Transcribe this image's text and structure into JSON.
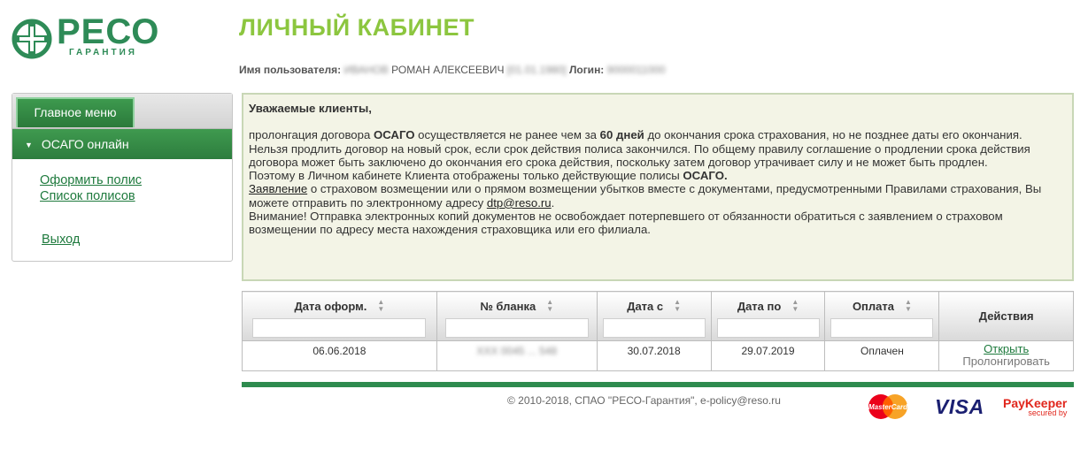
{
  "brand": {
    "name": "РЕСО",
    "subtitle": "ГАРАНТИЯ"
  },
  "header": {
    "title": "ЛИЧНЫЙ КАБИНЕТ",
    "user_label": "Имя пользователя:",
    "user_name": "РОМАН АЛЕКСЕЕВИЧ",
    "login_label": "Логин:"
  },
  "sidebar": {
    "main_menu": "Главное меню",
    "section": "ОСАГО онлайн",
    "links": [
      "Оформить полис",
      "Список полисов"
    ],
    "logout": "Выход"
  },
  "notice": {
    "greeting": "Уважаемые клиенты,",
    "p1_a": "пролонгация договора ",
    "p1_osago": "ОСАГО",
    "p1_b": " осуществляется не ранее чем за ",
    "p1_days": "60 дней",
    "p1_c": " до окончания срока страхования, но не позднее даты его окончания.",
    "p2": "Нельзя продлить договор на новый срок, если срок действия полиса закончился. По общему правилу соглашение о продлении срока действия договора может быть заключено до окончания его срока действия, поскольку затем договор утрачивает силу и не может быть продлен.",
    "p3_a": "Поэтому в Личном кабинете Клиента отображены только действующие полисы ",
    "p3_osago": "ОСАГО.",
    "p4_link": "Заявление",
    "p4_a": " о страховом возмещении или о прямом возмещении убытков вместе с документами, предусмотренными Правилами страхования, Вы можете отправить по электронному адресу ",
    "p4_email": "dtp@reso.ru",
    "p4_b": ".",
    "p5": "Внимание! Отправка электронных копий документов не освобождает потерпевшего от обязанности обратиться с заявлением о страховом возмещении по адресу места нахождения страховщика или его филиала."
  },
  "table": {
    "headers": [
      "Дата оформ.",
      "№ бланка",
      "Дата с",
      "Дата по",
      "Оплата",
      "Действия"
    ],
    "rows": [
      {
        "date_issued": "06.06.2018",
        "blank_no": "XXX 0045 ... 548",
        "date_from": "30.07.2018",
        "date_to": "29.07.2019",
        "payment": "Оплачен",
        "action_open": "Открыть",
        "action_prolong": "Пролонгировать"
      }
    ]
  },
  "footer": {
    "copyright": "© 2010-2018, СПАО \"РЕСО-Гарантия\", e-policy@reso.ru",
    "payments": [
      "MasterCard",
      "VISA",
      "PayKeeper",
      "secured by"
    ]
  },
  "colors": {
    "brand_green": "#2e8b57",
    "title_green": "#8cc63f",
    "menu_green": "#2d7d3e",
    "notice_bg": "#f3f4e6"
  }
}
